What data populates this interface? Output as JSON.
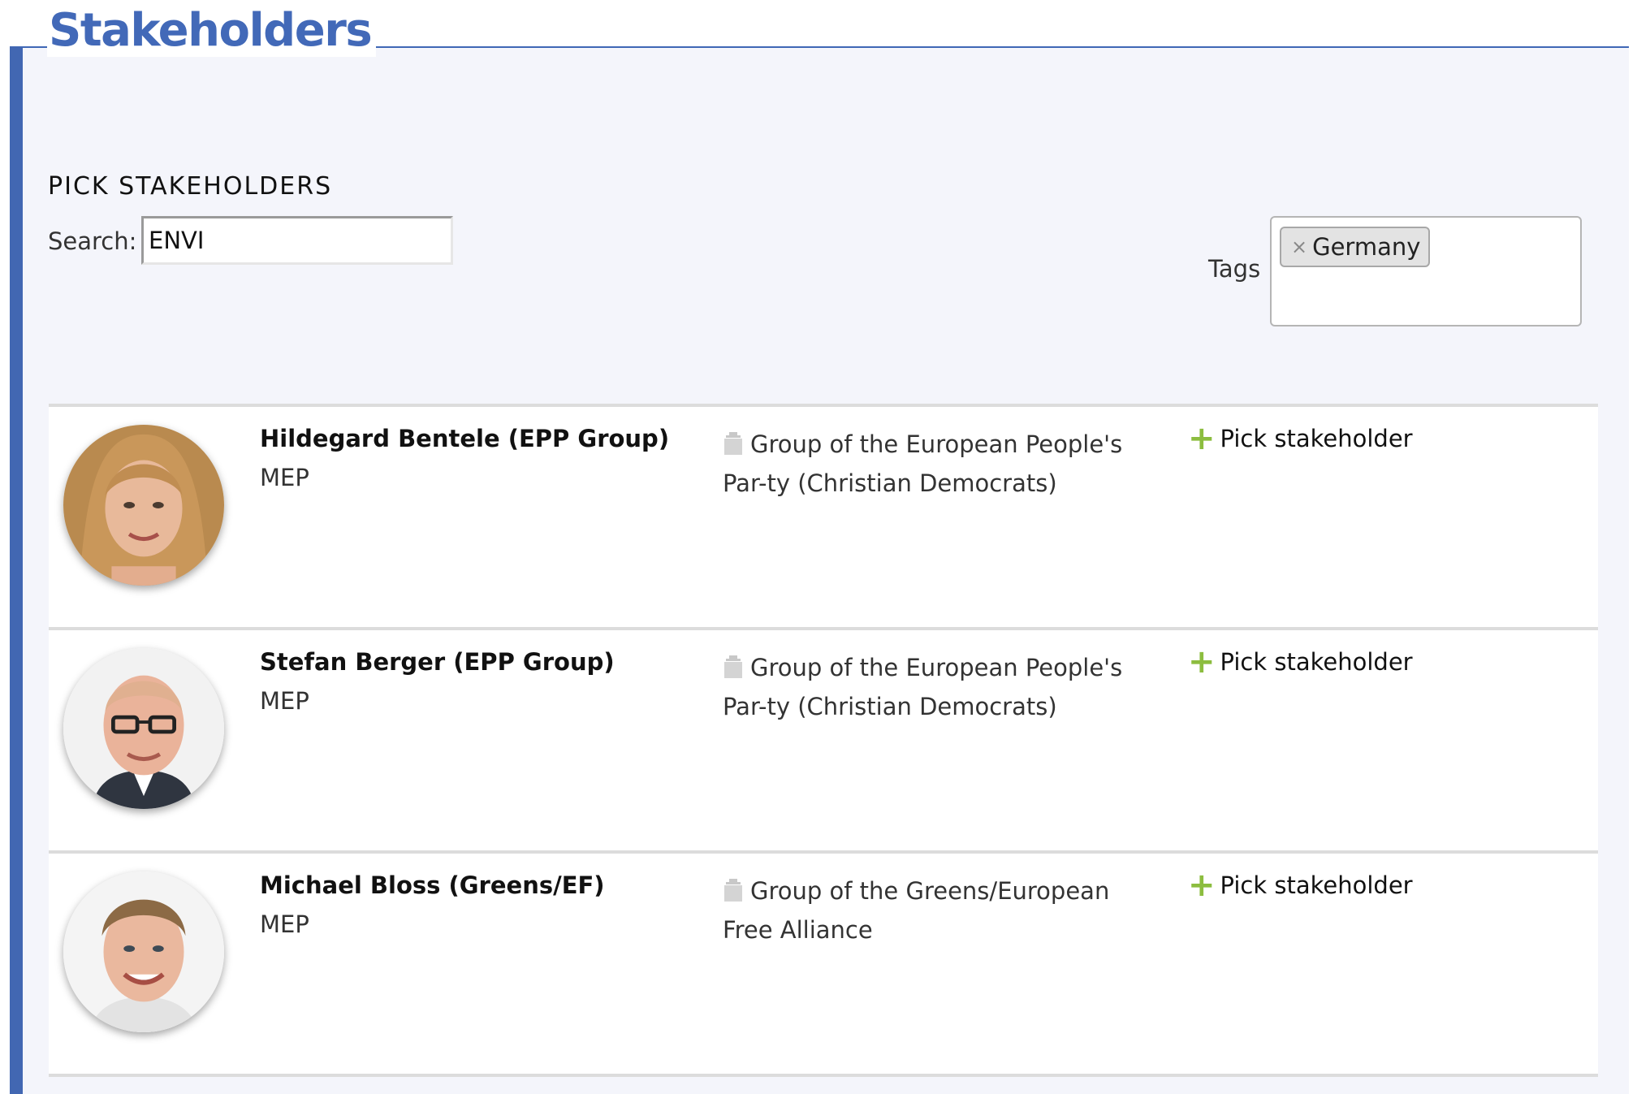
{
  "page": {
    "title": "Stakeholders"
  },
  "picker": {
    "heading": "PICK STAKEHOLDERS",
    "search_label": "Search:",
    "search_value": "ENVI",
    "tags_label": "Tags",
    "tags": [
      {
        "label": "Germany",
        "remove": "×"
      }
    ]
  },
  "colors": {
    "accent": "#4267b2",
    "title": "#4269b8",
    "plus": "#8cbd3f",
    "panel_bg": "#f4f5fb"
  },
  "stakeholders": [
    {
      "name": "Hildegard Bentele (EPP Group)",
      "role": "MEP",
      "org": "Group of the European People's Par-ty (Christian Democrats)",
      "org_icon": "building-icon",
      "action": "Pick stakeholder"
    },
    {
      "name": "Stefan Berger (EPP Group)",
      "role": "MEP",
      "org": "Group of the European People's Par-ty (Christian Democrats)",
      "org_icon": "building-icon",
      "action": "Pick stakeholder"
    },
    {
      "name": "Michael Bloss (Greens/EF)",
      "role": "MEP",
      "org": "Group of the Greens/European Free Alliance",
      "org_icon": "building-icon",
      "action": "Pick stakeholder"
    }
  ]
}
